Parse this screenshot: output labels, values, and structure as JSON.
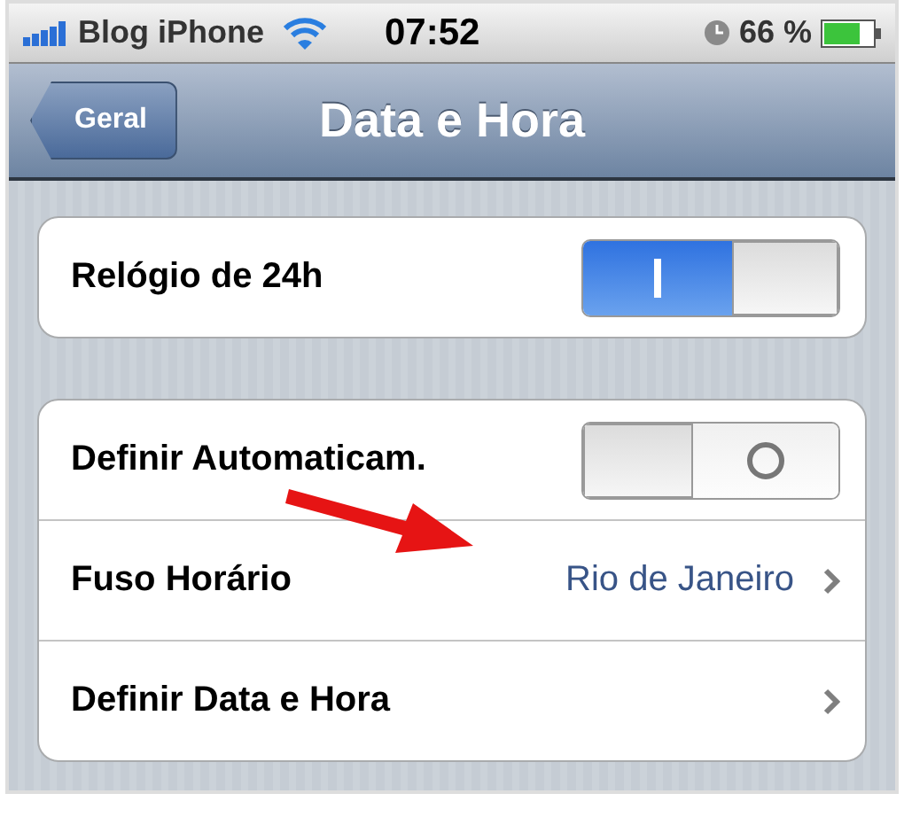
{
  "status_bar": {
    "carrier": "Blog iPhone",
    "time": "07:52",
    "battery": "66 %"
  },
  "nav_bar": {
    "back": "Geral",
    "title": "Data e Hora"
  },
  "groups": [
    {
      "rows": [
        {
          "kind": "toggle",
          "label": "Relógio de 24h",
          "on": true
        }
      ]
    },
    {
      "rows": [
        {
          "kind": "toggle",
          "label": "Definir Automaticam.",
          "on": false
        },
        {
          "kind": "detail",
          "label": "Fuso Horário",
          "value": "Rio de Janeiro"
        },
        {
          "kind": "link",
          "label": "Definir Data e Hora"
        }
      ]
    }
  ]
}
